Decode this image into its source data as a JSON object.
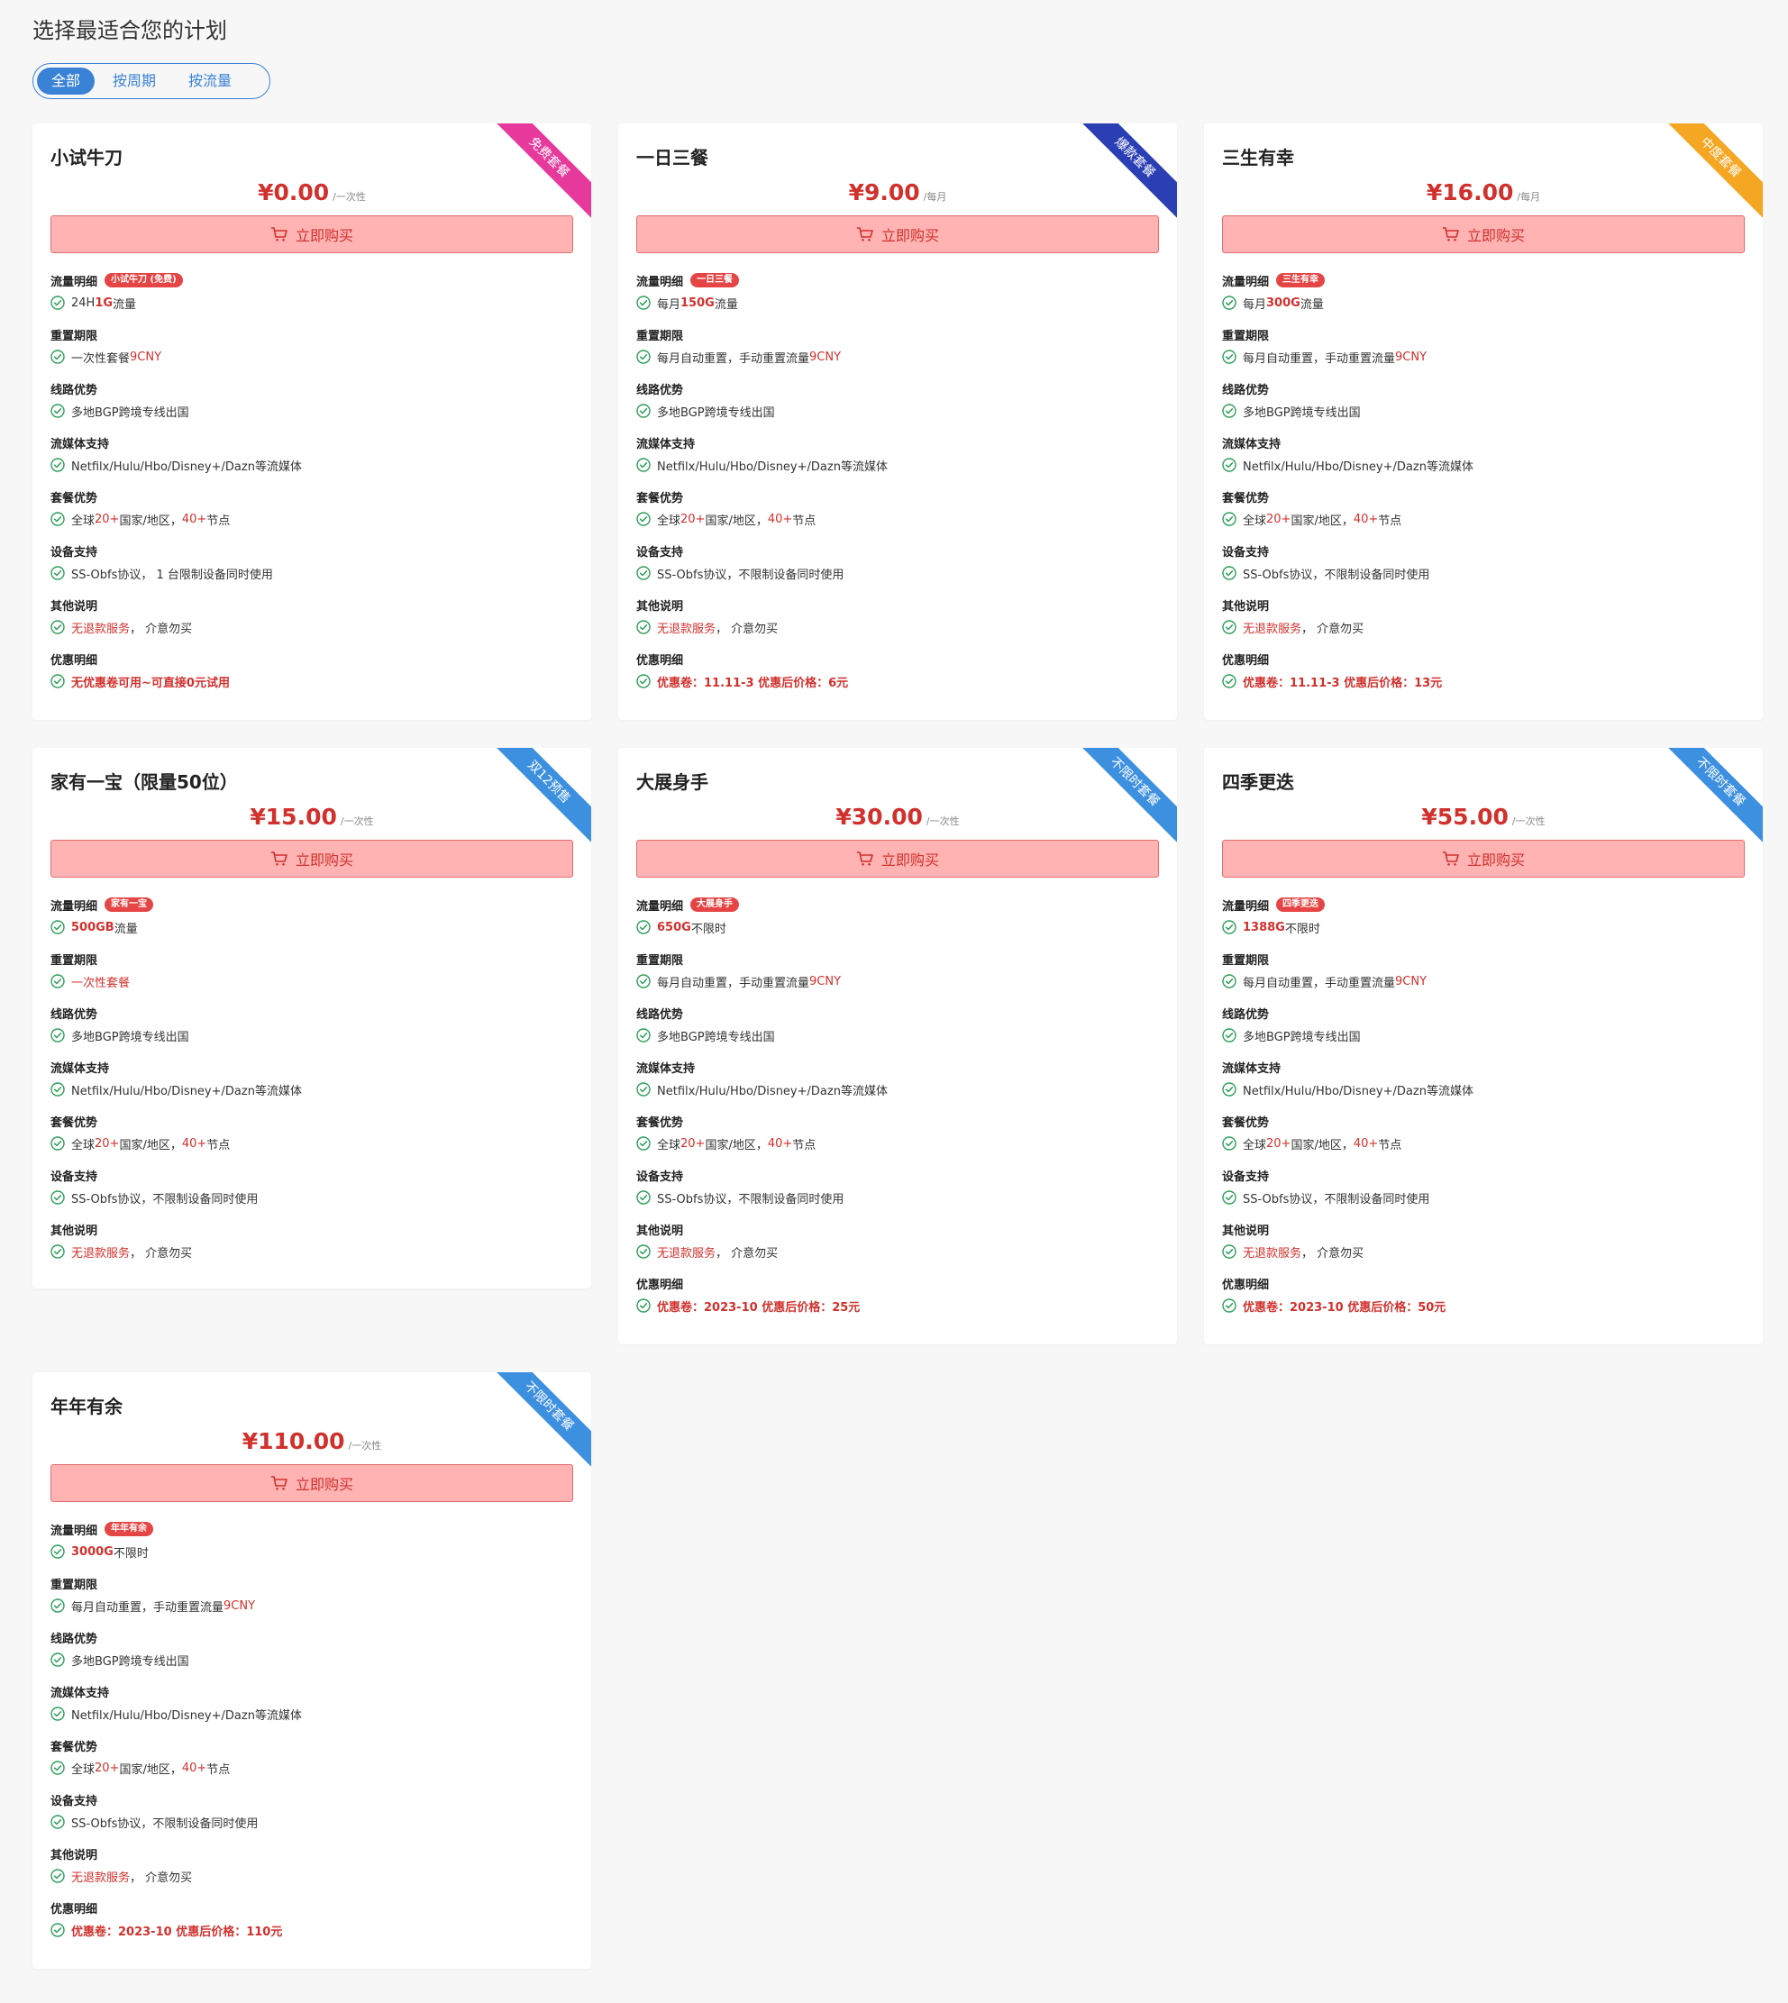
{
  "page": {
    "title": "选择最适合您的计划"
  },
  "filter": {
    "options": [
      "全部",
      "按周期",
      "按流量"
    ],
    "active": "全部"
  },
  "buy_label": "立即购买",
  "section_labels": {
    "traffic": "流量明细",
    "reset": "重置期限",
    "route": "线路优势",
    "media": "流媒体支持",
    "advantage": "套餐优势",
    "device": "设备支持",
    "other": "其他说明",
    "discount": "优惠明细"
  },
  "plans": [
    {
      "name": "小试牛刀",
      "price": "¥0.00",
      "per": "/一次性",
      "ribbon": "免费套餐",
      "ribbon_color": "#e6399b",
      "traffic_tag": "小试牛刀 (免费)",
      "traffic": [
        "24H ",
        "1G",
        " 流量"
      ],
      "reset": [
        "一次性套餐 ",
        "9CNY",
        ""
      ],
      "route": "多地BGP跨境专线出国",
      "media": "Netfilx/Hulu/Hbo/Disney+/Dazn等流媒体",
      "advantage": [
        "全球 ",
        "20+",
        " 国家/地区，  ",
        "40+",
        " 节点"
      ],
      "device": "SS-Obfs协议，  1 台限制设备同时使用",
      "other": [
        "无退款服务",
        "，  介意勿买"
      ],
      "discount": "无优惠卷可用~可直接0元试用"
    },
    {
      "name": "一日三餐",
      "price": "¥9.00",
      "per": "/每月",
      "ribbon": "爆款套餐",
      "ribbon_color": "#2b3fb5",
      "traffic_tag": "一日三餐",
      "traffic": [
        "每月 ",
        "150G",
        " 流量"
      ],
      "reset": [
        "每月自动重置，手动重置流量 ",
        "9CNY",
        ""
      ],
      "route": "多地BGP跨境专线出国",
      "media": "Netfilx/Hulu/Hbo/Disney+/Dazn等流媒体",
      "advantage": [
        "全球 ",
        "20+",
        " 国家/地区，  ",
        "40+",
        " 节点"
      ],
      "device": "SS-Obfs协议，不限制设备同时使用",
      "other": [
        "无退款服务",
        "，  介意勿买"
      ],
      "discount": "优惠卷：11.11-3 优惠后价格：6元"
    },
    {
      "name": "三生有幸",
      "price": "¥16.00",
      "per": "/每月",
      "ribbon": "中度套餐",
      "ribbon_color": "#f5a623",
      "traffic_tag": "三生有幸",
      "traffic": [
        "每月 ",
        "300G",
        " 流量"
      ],
      "reset": [
        "每月自动重置，手动重置流量 ",
        "9CNY",
        ""
      ],
      "route": "多地BGP跨境专线出国",
      "media": "Netfilx/Hulu/Hbo/Disney+/Dazn等流媒体",
      "advantage": [
        "全球 ",
        "20+",
        " 国家/地区，  ",
        "40+",
        " 节点"
      ],
      "device": "SS-Obfs协议，不限制设备同时使用",
      "other": [
        "无退款服务",
        "，  介意勿买"
      ],
      "discount": "优惠卷：11.11-3 优惠后价格：13元"
    },
    {
      "name": "家有一宝（限量50位）",
      "price": "¥15.00",
      "per": "/一次性",
      "ribbon": "双12预售",
      "ribbon_color": "#3d8fe0",
      "traffic_tag": "家有一宝",
      "traffic": [
        "",
        "500GB",
        " 流量"
      ],
      "reset": [
        "",
        "一次性套餐",
        ""
      ],
      "route": "多地BGP跨境专线出国",
      "media": "Netfilx/Hulu/Hbo/Disney+/Dazn等流媒体",
      "advantage": [
        "全球 ",
        "20+",
        " 国家/地区，  ",
        "40+",
        " 节点"
      ],
      "device": "SS-Obfs协议，不限制设备同时使用",
      "other": [
        "无退款服务",
        "，  介意勿买"
      ],
      "discount": ""
    },
    {
      "name": "大展身手",
      "price": "¥30.00",
      "per": "/一次性",
      "ribbon": "不限时套餐",
      "ribbon_color": "#3d8fe0",
      "traffic_tag": "大展身手",
      "traffic": [
        "",
        "650G",
        " 不限时"
      ],
      "reset": [
        "每月自动重置，手动重置流量 ",
        "9CNY",
        ""
      ],
      "route": "多地BGP跨境专线出国",
      "media": "Netfilx/Hulu/Hbo/Disney+/Dazn等流媒体",
      "advantage": [
        "全球 ",
        "20+",
        " 国家/地区，  ",
        "40+",
        " 节点"
      ],
      "device": "SS-Obfs协议，不限制设备同时使用",
      "other": [
        "无退款服务",
        "，  介意勿买"
      ],
      "discount": "优惠卷：2023-10 优惠后价格：25元"
    },
    {
      "name": "四季更迭",
      "price": "¥55.00",
      "per": "/一次性",
      "ribbon": "不限时套餐",
      "ribbon_color": "#3d8fe0",
      "traffic_tag": "四季更迭",
      "traffic": [
        "",
        "1388G",
        " 不限时"
      ],
      "reset": [
        "每月自动重置，手动重置流量 ",
        "9CNY",
        ""
      ],
      "route": "多地BGP跨境专线出国",
      "media": "Netfilx/Hulu/Hbo/Disney+/Dazn等流媒体",
      "advantage": [
        "全球 ",
        "20+",
        " 国家/地区，  ",
        "40+",
        " 节点"
      ],
      "device": "SS-Obfs协议，不限制设备同时使用",
      "other": [
        "无退款服务",
        "，  介意勿买"
      ],
      "discount": "优惠卷：2023-10 优惠后价格：50元"
    },
    {
      "name": "年年有余",
      "price": "¥110.00",
      "per": "/一次性",
      "ribbon": "不限时套餐",
      "ribbon_color": "#3d8fe0",
      "traffic_tag": "年年有余",
      "traffic": [
        "",
        "3000G",
        " 不限时"
      ],
      "reset": [
        "每月自动重置，手动重置流量 ",
        "9CNY",
        ""
      ],
      "route": "多地BGP跨境专线出国",
      "media": "Netfilx/Hulu/Hbo/Disney+/Dazn等流媒体",
      "advantage": [
        "全球 ",
        "20+",
        " 国家/地区，  ",
        "40+",
        " 节点"
      ],
      "device": "SS-Obfs协议，不限制设备同时使用",
      "other": [
        "无退款服务",
        "，  介意勿买"
      ],
      "discount": "优惠卷：2023-10 优惠后价格：110元"
    }
  ]
}
